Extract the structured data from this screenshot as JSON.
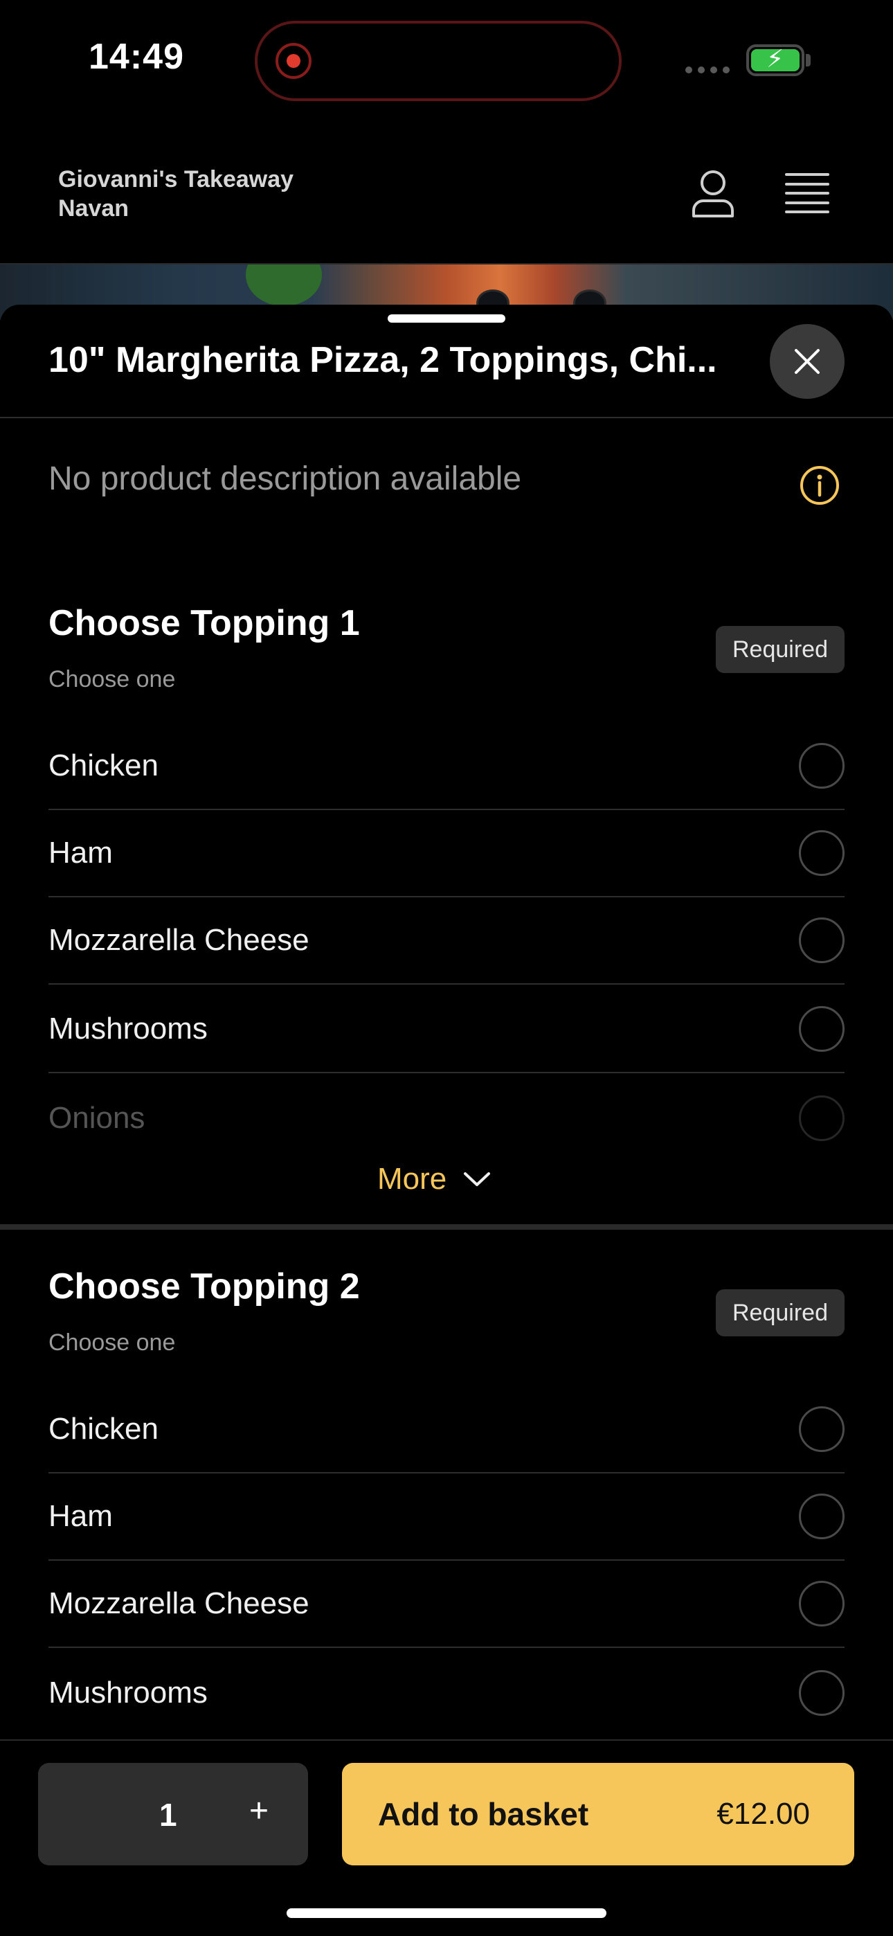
{
  "status_bar": {
    "time": "14:49",
    "icons": [
      "screen-recording-icon",
      "cellular-signal-icon",
      "battery-charging-icon"
    ]
  },
  "header": {
    "store_name_line1": "Giovanni's Takeaway",
    "store_name_line2": "Navan",
    "icons": [
      "user-profile-icon",
      "hamburger-menu-icon"
    ]
  },
  "product": {
    "title": "10\" Margherita Pizza, 2 Toppings, Chi...",
    "description": "No product description available"
  },
  "sections": [
    {
      "title": "Choose Topping 1",
      "subtitle": "Choose one",
      "badge": "Required",
      "options": [
        "Chicken",
        "Ham",
        "Mozzarella Cheese",
        "Mushrooms",
        "Onions"
      ],
      "more_label": "More"
    },
    {
      "title": "Choose Topping 2",
      "subtitle": "Choose one",
      "badge": "Required",
      "options": [
        "Chicken",
        "Ham",
        "Mozzarella Cheese",
        "Mushrooms"
      ]
    }
  ],
  "footer": {
    "quantity": "1",
    "plus_label": "+",
    "add_label": "Add to basket",
    "price": "€12.00"
  },
  "colors": {
    "accent": "#f6c65a",
    "background": "#000000",
    "badge_bg": "#2f2f2f"
  }
}
